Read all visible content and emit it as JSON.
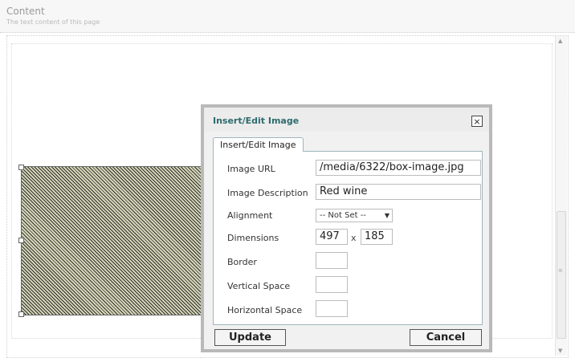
{
  "page": {
    "title": "Content",
    "subtitle": "The text content of this page"
  },
  "dialog": {
    "title": "Insert/Edit Image",
    "close_label": "×",
    "tab_label": "Insert/Edit Image",
    "fields": {
      "image_url": {
        "label": "Image URL",
        "value": "/media/6322/box-image.jpg"
      },
      "image_description": {
        "label": "Image Description",
        "value": "Red wine"
      },
      "alignment": {
        "label": "Alignment",
        "value": "-- Not Set --"
      },
      "dimensions": {
        "label": "Dimensions",
        "width": "497",
        "separator": "x",
        "height": "185"
      },
      "border": {
        "label": "Border",
        "value": ""
      },
      "vertical_space": {
        "label": "Vertical Space",
        "value": ""
      },
      "horizontal_space": {
        "label": "Horizontal Space",
        "value": ""
      }
    },
    "buttons": {
      "update": "Update",
      "cancel": "Cancel"
    }
  },
  "icons": {
    "scroll_up": "scroll-up-icon",
    "scroll_down": "scroll-down-icon",
    "select_arrow": "chevron-down-icon",
    "close": "close-icon"
  },
  "colors": {
    "dialog_title": "#2d6b6d",
    "tab_border": "#9fb5bf"
  }
}
